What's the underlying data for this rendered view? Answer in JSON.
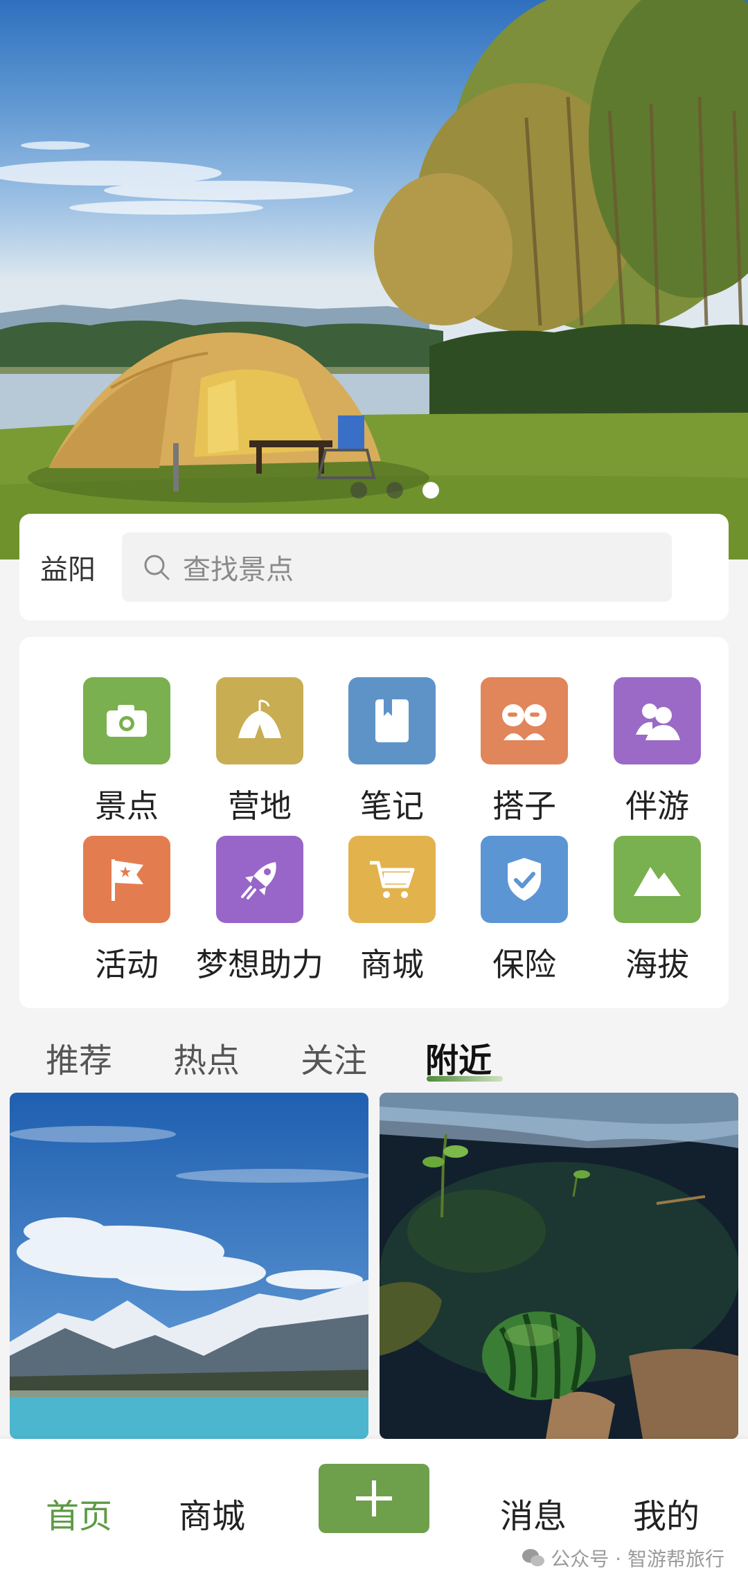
{
  "banner": {
    "slides": 3,
    "active_slide": 3
  },
  "search": {
    "city": "益阳",
    "placeholder": "查找景点"
  },
  "categories": [
    {
      "label": "景点",
      "icon": "camera-icon",
      "color": "#7ab04f"
    },
    {
      "label": "营地",
      "icon": "tent-icon",
      "color": "#c9ad52"
    },
    {
      "label": "笔记",
      "icon": "notebook-icon",
      "color": "#5e93c8"
    },
    {
      "label": "搭子",
      "icon": "partners-icon",
      "color": "#e1855a"
    },
    {
      "label": "伴游",
      "icon": "companion-icon",
      "color": "#9a6ac6"
    },
    {
      "label": "活动",
      "icon": "flag-icon",
      "color": "#e37d50"
    },
    {
      "label": "梦想助力",
      "icon": "rocket-icon",
      "color": "#9865c8"
    },
    {
      "label": "商城",
      "icon": "cart-icon",
      "color": "#e2b24d"
    },
    {
      "label": "保险",
      "icon": "shield-icon",
      "color": "#5b95d4"
    },
    {
      "label": "海拔",
      "icon": "mountain-icon",
      "color": "#79b050"
    }
  ],
  "tabs": {
    "recommend": "推荐",
    "hot": "热点",
    "follow": "关注",
    "nearby": "附近",
    "active": "附近"
  },
  "nav": {
    "home": "首页",
    "mall": "商城",
    "messages": "消息",
    "mine": "我的",
    "active": "首页",
    "accent": "#5c9a44"
  },
  "watermark": "公众号 · 智游帮旅行"
}
